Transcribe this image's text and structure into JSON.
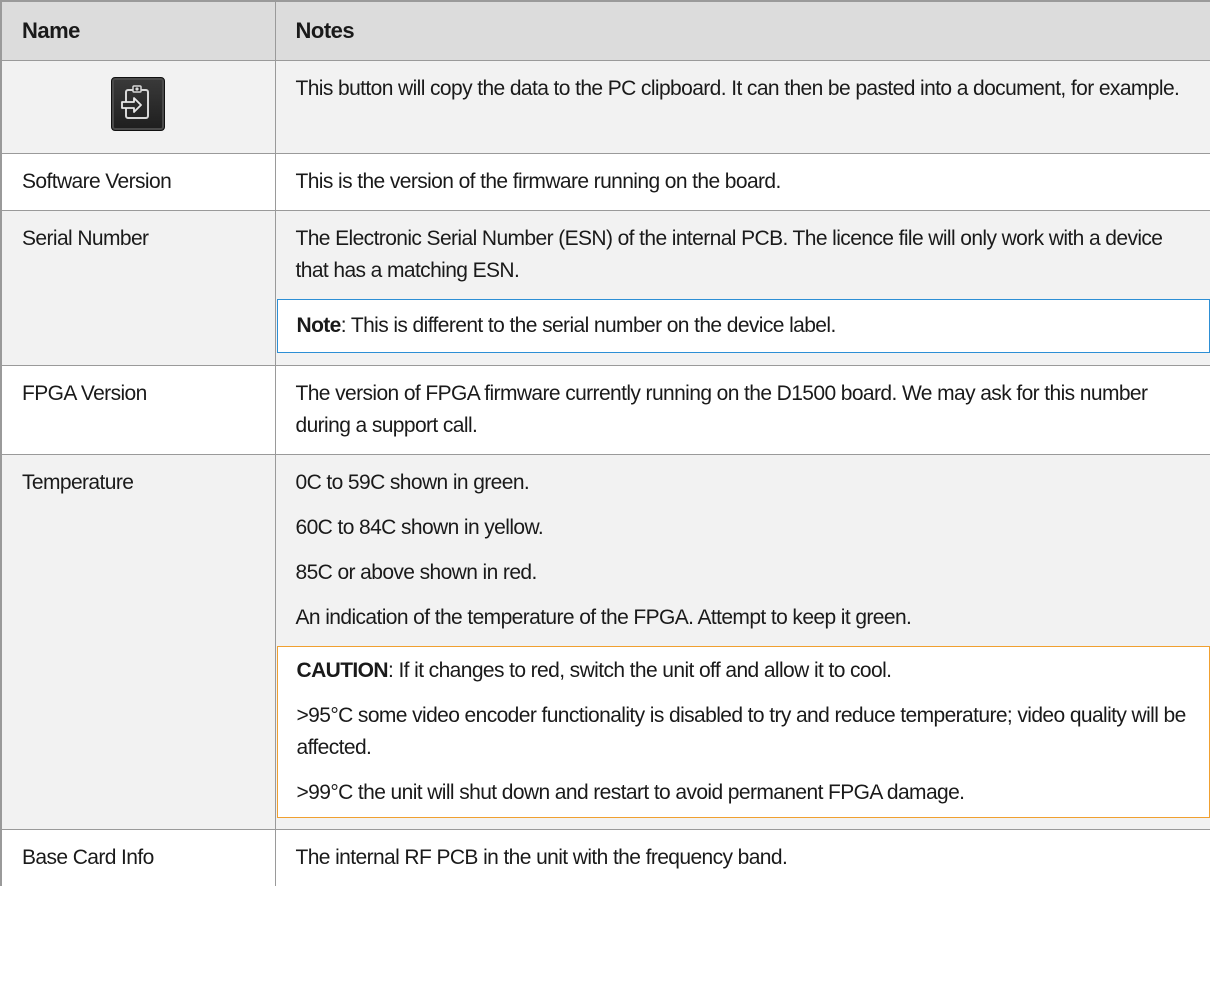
{
  "table": {
    "headers": {
      "name": "Name",
      "notes": "Notes"
    },
    "copy_row": {
      "icon": "clipboard-copy-icon",
      "note": "This button will copy the data to the PC clipboard. It can then be pasted into a document, for example."
    },
    "software_version": {
      "name": "Software Version",
      "note": "This is the version of the firmware running on the board."
    },
    "serial_number": {
      "name": "Serial Number",
      "note": "The Electronic Serial Number (ESN) of the internal PCB. The licence file will only work with a device that has a matching ESN.",
      "callout_label": "Note",
      "callout_text": ": This is different to the serial number on the device label."
    },
    "fpga_version": {
      "name": "FPGA Version",
      "note": "The version of FPGA firmware currently running on the D1500 board. We may ask for this number during a support call."
    },
    "temperature": {
      "name": "Temperature",
      "line1": "0C to 59C shown in green.",
      "line2": "60C to 84C shown in yellow.",
      "line3": "85C or above shown in red.",
      "line4": "An indication of the temperature of the FPGA. Attempt to keep it green.",
      "caution_label": "CAUTION",
      "caution_text": ": If it changes to red, switch the unit off and allow it to cool.",
      "caution_line2": ">95°C some video encoder functionality is disabled to try and reduce temperature; video quality will be affected.",
      "caution_line3": ">99°C the unit will shut down and restart to avoid permanent FPGA damage."
    },
    "base_card_info": {
      "name": "Base Card Info",
      "note": "The internal RF PCB in the unit with the frequency band."
    }
  },
  "colors": {
    "header_bg": "#dcdcdc",
    "alt_row_bg": "#f2f2f2",
    "note_border": "#2d8fd5",
    "caution_border": "#f0a030"
  }
}
